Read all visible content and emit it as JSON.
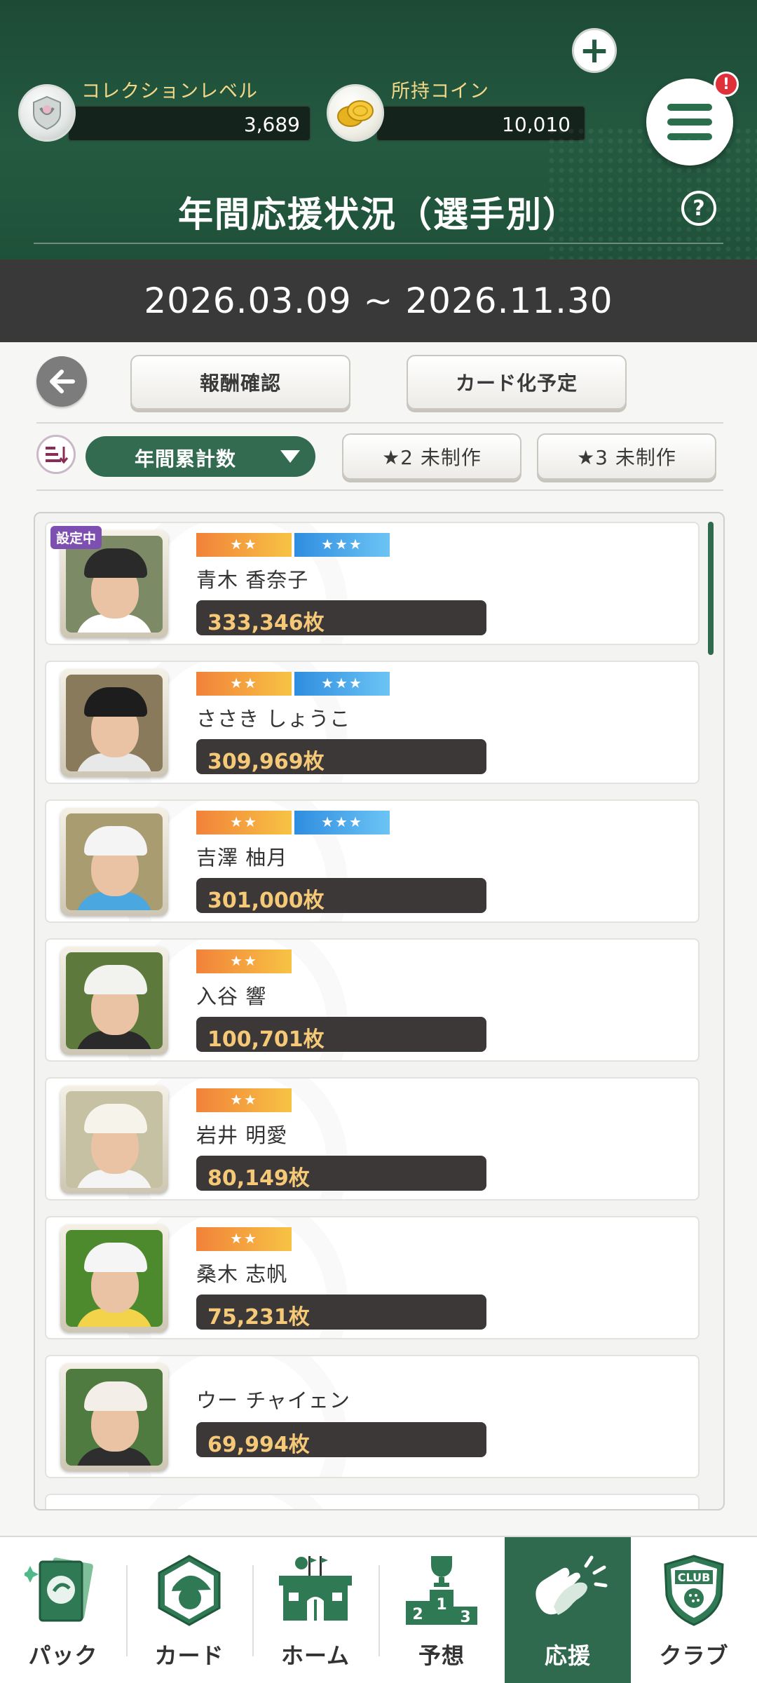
{
  "header": {
    "collection_level_label": "コレクションレベル",
    "collection_level_value": "3,689",
    "coins_label": "所持コイン",
    "coins_value": "10,010",
    "menu_badge": "!",
    "title": "年間応援状況（選手別）",
    "help_label": "?"
  },
  "date_range": "2026.03.09 ~ 2026.11.30",
  "controls": {
    "reward_button": "報酬確認",
    "card_plan_button": "カード化予定",
    "sort_selected": "年間累計数",
    "filter_star2": "★2 未制作",
    "filter_star3": "★3 未制作"
  },
  "list": {
    "setting_badge": "設定中",
    "players": [
      {
        "name": "青木 香奈子",
        "count": "333,346枚",
        "rarity": [
          "★★",
          "★★★"
        ],
        "cap": "#2a2a2a",
        "shirt": "#ffffff",
        "bg": "#7c8a66"
      },
      {
        "name": "ささき しょうこ",
        "count": "309,969枚",
        "rarity": [
          "★★",
          "★★★"
        ],
        "cap": "#1d1d1d",
        "shirt": "#e8e8e8",
        "bg": "#8a7a5c"
      },
      {
        "name": "吉澤 柚月",
        "count": "301,000枚",
        "rarity": [
          "★★",
          "★★★"
        ],
        "cap": "#f4f4f4",
        "shirt": "#4aa7e0",
        "bg": "#a89c70"
      },
      {
        "name": "入谷 響",
        "count": "100,701枚",
        "rarity": [
          "★★"
        ],
        "cap": "#f2f2ee",
        "shirt": "#2a2a2a",
        "bg": "#5d7a3c"
      },
      {
        "name": "岩井 明愛",
        "count": "80,149枚",
        "rarity": [
          "★★"
        ],
        "cap": "#f6f3ea",
        "shirt": "#f4f4f4",
        "bg": "#c7c1a3"
      },
      {
        "name": "桑木 志帆",
        "count": "75,231枚",
        "rarity": [
          "★★"
        ],
        "cap": "#f5f5f5",
        "shirt": "#f2d34a",
        "bg": "#4d8a2e"
      },
      {
        "name": "ウー チャイェン",
        "count": "69,994枚",
        "rarity": [],
        "cap": "#f3eee8",
        "shirt": "#2e2e2e",
        "bg": "#4f7a40"
      }
    ]
  },
  "nav": [
    {
      "label": "パック",
      "icon": "pack-icon",
      "active": false
    },
    {
      "label": "カード",
      "icon": "card-icon",
      "active": false
    },
    {
      "label": "ホーム",
      "icon": "home-icon",
      "active": false
    },
    {
      "label": "予想",
      "icon": "podium-icon",
      "active": false
    },
    {
      "label": "応援",
      "icon": "clap-icon",
      "active": true
    },
    {
      "label": "クラブ",
      "icon": "club-icon",
      "active": false
    }
  ],
  "colors": {
    "header_green": "#245a40",
    "accent_green": "#2f6a4e",
    "count_text": "#f5c978"
  }
}
